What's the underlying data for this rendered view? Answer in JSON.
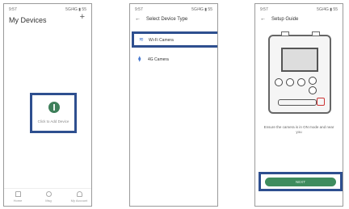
{
  "screen1": {
    "status_time": "9:57",
    "status_sys": "5G/4G ▮ 55",
    "title": "My Devices",
    "add_icon": "plus-icon",
    "add_label": "Click to Add Device",
    "tabs": [
      {
        "label": "Home",
        "icon": "home-icon"
      },
      {
        "label": "Msg",
        "icon": "message-icon"
      },
      {
        "label": "My Account",
        "icon": "account-icon"
      }
    ]
  },
  "screen2": {
    "status_time": "9:57",
    "status_sys": "5G/4G ▮ 55",
    "title": "Select Device Type",
    "items": [
      {
        "label": "Wi-Fi Camera",
        "icon": "wifi-icon"
      },
      {
        "label": "4G Camera",
        "icon": "4g-icon"
      }
    ]
  },
  "screen3": {
    "status_time": "9:57",
    "status_sys": "5G/4G ▮ 55",
    "title": "Setup Guide",
    "instruction": "Ensure the camera is in ON mode and near you",
    "next_label": "NEXT"
  },
  "colors": {
    "highlight": "#2e4f8f",
    "accent_green": "#3e8c5e"
  }
}
